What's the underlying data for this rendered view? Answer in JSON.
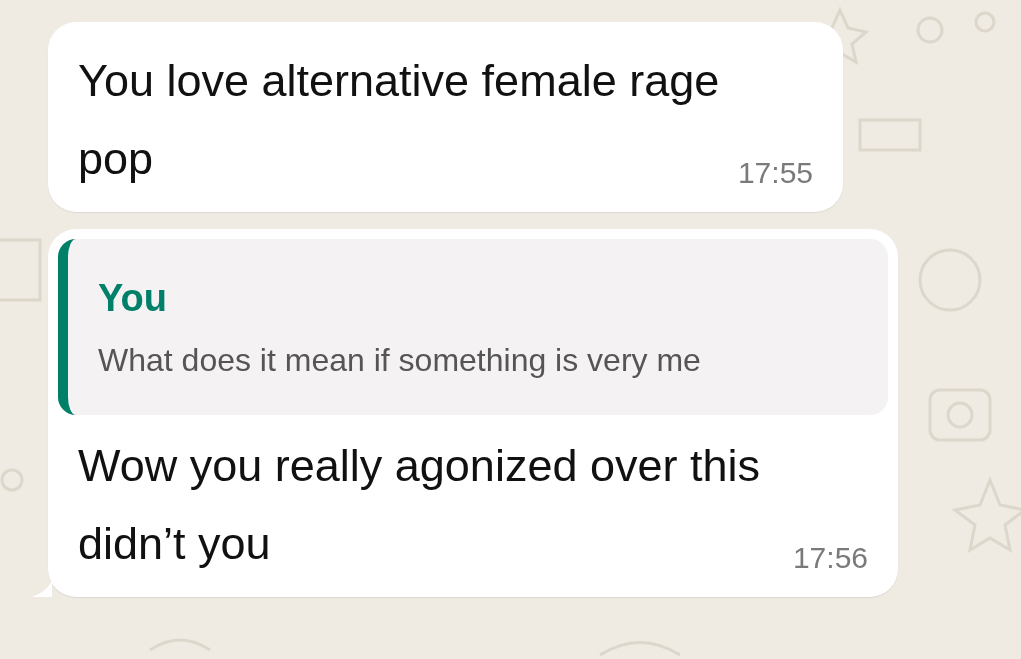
{
  "messages": [
    {
      "kind": "plain",
      "text": "You love alternative female rage pop",
      "time": "17:55",
      "tail": false
    },
    {
      "kind": "reply",
      "quote": {
        "author": "You",
        "text": "What does it mean if something is very me"
      },
      "text": "Wow you really agonized over this didn’t you",
      "time": "17:56",
      "tail": true
    }
  ]
}
